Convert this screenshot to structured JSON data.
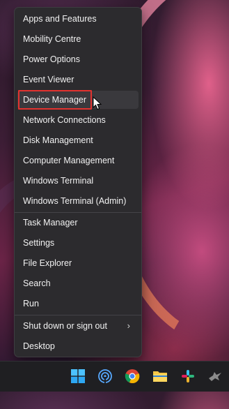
{
  "menu": {
    "items": [
      {
        "label": "Apps and Features"
      },
      {
        "label": "Mobility Centre"
      },
      {
        "label": "Power Options"
      },
      {
        "label": "Event Viewer"
      },
      {
        "label": "Device Manager"
      },
      {
        "label": "Network Connections"
      },
      {
        "label": "Disk Management"
      },
      {
        "label": "Computer Management"
      },
      {
        "label": "Windows Terminal"
      },
      {
        "label": "Windows Terminal (Admin)"
      },
      {
        "label": "Task Manager"
      },
      {
        "label": "Settings"
      },
      {
        "label": "File Explorer"
      },
      {
        "label": "Search"
      },
      {
        "label": "Run"
      },
      {
        "label": "Shut down or sign out"
      },
      {
        "label": "Desktop"
      }
    ],
    "highlighted_item": "Device Manager",
    "highlight_color": "#e3322f"
  },
  "taskbar": {
    "icons": [
      "windows-start-icon",
      "network-icon",
      "chrome-icon",
      "file-explorer-icon",
      "slack-icon",
      "bird-app-icon"
    ]
  }
}
